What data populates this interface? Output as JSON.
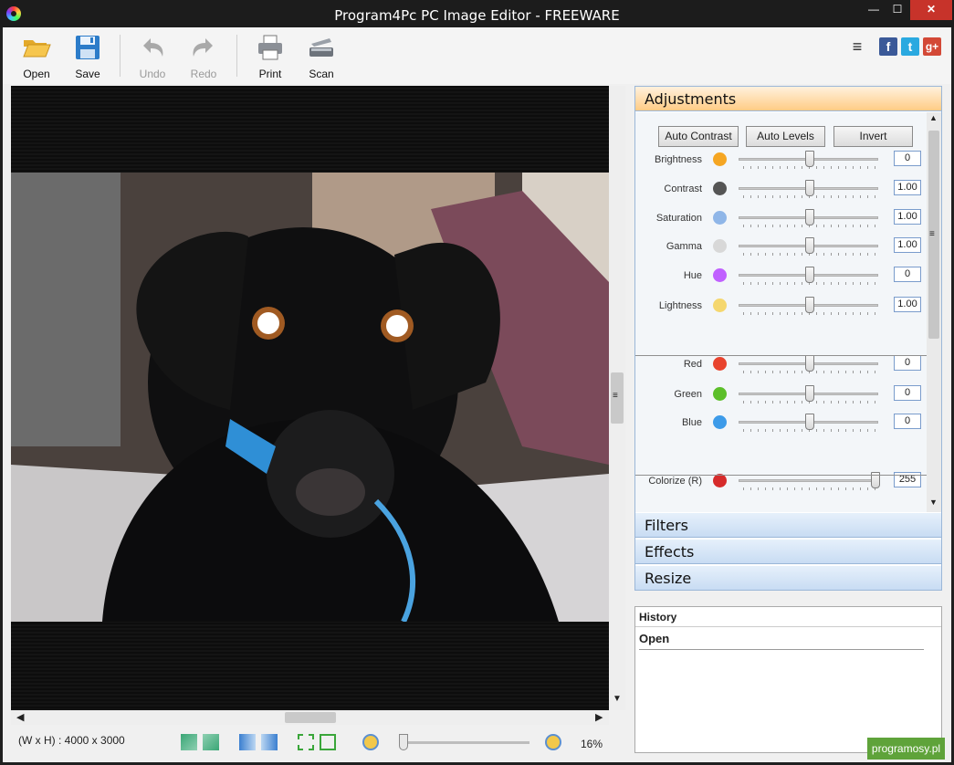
{
  "window": {
    "title": "Program4Pc PC Image Editor - FREEWARE",
    "min_label": "—",
    "max_label": "☐",
    "close_label": "✕"
  },
  "toolbar": {
    "open": "Open",
    "save": "Save",
    "undo": "Undo",
    "redo": "Redo",
    "print": "Print",
    "scan": "Scan",
    "menu_icon": "≡",
    "facebook": "f",
    "twitter": "t",
    "gplus": "g+"
  },
  "status": {
    "dimensions": "(W x H) : 4000 x 3000",
    "zoom": "16%",
    "zoom_level": 0.16
  },
  "panel": {
    "adjustments": "Adjustments",
    "auto_contrast": "Auto Contrast",
    "auto_levels": "Auto Levels",
    "invert": "Invert",
    "rows": [
      {
        "label": "Brightness",
        "value": "0",
        "pos": 0.5,
        "icon": "sun-icon",
        "color": "#f5a623"
      },
      {
        "label": "Contrast",
        "value": "1.00",
        "pos": 0.5,
        "icon": "contrast-icon",
        "color": "#555555"
      },
      {
        "label": "Saturation",
        "value": "1.00",
        "pos": 0.5,
        "icon": "saturation-icon",
        "color": "#8fb6e8"
      },
      {
        "label": "Gamma",
        "value": "1.00",
        "pos": 0.5,
        "icon": "gamma-icon",
        "color": "#d8d8d8"
      },
      {
        "label": "Hue",
        "value": "0",
        "pos": 0.5,
        "icon": "hue-wheel-icon",
        "color": "#c060ff"
      },
      {
        "label": "Lightness",
        "value": "1.00",
        "pos": 0.5,
        "icon": "bulb-icon",
        "color": "#f5d76e"
      },
      {
        "label": "Red",
        "value": "0",
        "pos": 0.5,
        "icon": "red-dot-icon",
        "color": "#e8432e"
      },
      {
        "label": "Green",
        "value": "0",
        "pos": 0.5,
        "icon": "green-dot-icon",
        "color": "#5cbf2a"
      },
      {
        "label": "Blue",
        "value": "0",
        "pos": 0.5,
        "icon": "blue-dot-icon",
        "color": "#3d9be9"
      },
      {
        "label": "Colorize (R)",
        "value": "255",
        "pos": 1.0,
        "icon": "arrow-down-icon",
        "color": "#d62b2b"
      }
    ],
    "filters": "Filters",
    "effects": "Effects",
    "resize": "Resize"
  },
  "history": {
    "title": "History",
    "items": [
      "Open"
    ]
  },
  "watermark": "programosy.pl"
}
